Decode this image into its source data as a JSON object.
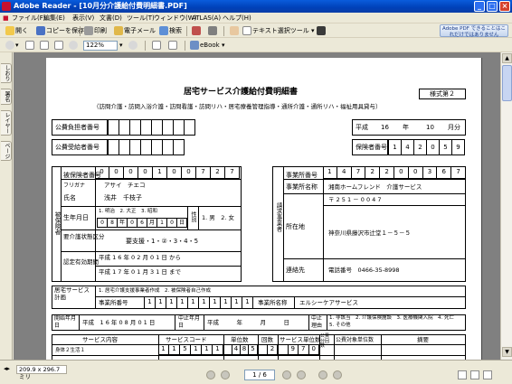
{
  "window": {
    "title": "Adobe Reader - [10月分介護給付費明細書.PDF]",
    "minimize": "_",
    "maximize": "□",
    "close": "×"
  },
  "menu": [
    "ファイル(F)",
    "編集(E)",
    "表示(V)",
    "文書(D)",
    "ツール(T)",
    "ウィンドウ(W)",
    "ATLAS(A)",
    "ヘルプ(H)"
  ],
  "toolbar1": {
    "open": "開く",
    "save_copy": "コピーを保存",
    "print": "印刷",
    "email": "電子メール",
    "search": "検索",
    "text_select": "テキスト選択ツール"
  },
  "toolbar2": {
    "zoom": "122%",
    "ebook": "eBook"
  },
  "adobe_ad": "Adobe PDF できることはこれだけではありません",
  "side_tabs": [
    "しおり",
    "署名",
    "レイヤー",
    "ページ"
  ],
  "status": {
    "page_size": "209.9 x 296.7 ミリ",
    "page_indicator": "1 / 6"
  },
  "form": {
    "title": "居宅サービス介護給付費明細書",
    "subtitle": "（訪問介護・訪問入浴介護・訪問看護・訪問リハ・居宅療養管理指導・通所介護・通所リハ・福祉用具貸与）",
    "form_no": "様式第２",
    "public_payer_label": "公費負担者番号",
    "public_recipient_label": "公費受給者番号",
    "era_label": "平成",
    "year": "16",
    "year_label": "年",
    "month": "10",
    "month_label": "月分",
    "insurer_label": "保険者番号",
    "insurer_no": [
      "1",
      "4",
      "2",
      "0",
      "5",
      "9"
    ],
    "insured_no_label": "被保険者番号",
    "insured_no": [
      "0",
      "0",
      "0",
      "0",
      "1",
      "0",
      "0",
      "7",
      "2",
      "7"
    ],
    "furigana_label": "フリガナ",
    "furigana": "アサイ　チエコ",
    "name_label": "氏名",
    "name": "浅井　千枝子",
    "birth_label": "生年月日",
    "birth_era_options": "1. 明治　2. 大正　3. 昭和",
    "birth_era_selected": "2",
    "birth_date": [
      "0",
      "8",
      "年",
      "0",
      "6",
      "月",
      "1",
      "0",
      "日"
    ],
    "gender_label": "性別",
    "gender_options": "1. 男　2. 女",
    "care_level_label": "要介護状態区分",
    "care_level": "要支援・1・②・3・4・5",
    "cert_period_label": "認定有効期間",
    "cert_from": "平成 1 6 年 0 2 月 0 1 日 から",
    "cert_to": "平成 1 7 年 0 1 月 3 1 日 まで",
    "insured_side_label": "被保険者",
    "provider_side_label": "請求事業者",
    "provider_no_label": "事業所番号",
    "provider_no": [
      "1",
      "4",
      "7",
      "2",
      "2",
      "0",
      "0",
      "3",
      "6",
      "7"
    ],
    "provider_name_label": "事業所名称",
    "provider_name": "湘南ホームフレンド　介護サービス",
    "postal": "〒 2 5 1 － 0 0 4 7",
    "address_label": "所在地",
    "address": "神奈川県藤沢市辻堂１－５－５",
    "contact_label": "連絡先",
    "phone": "電話番号　0466-35-8998",
    "care_plan_label": "居宅サービス計画",
    "care_plan_options": "1. 居宅介護支援事業者作成　2. 被保険者自己作成",
    "care_plan_provider_no_label": "事業所番号",
    "care_plan_provider_no": [
      "1",
      "1",
      "1",
      "1",
      "1",
      "1",
      "1",
      "1",
      "1",
      "1"
    ],
    "care_plan_provider_name_label": "事業所名称",
    "care_plan_provider_name": "エルシーケアサービス",
    "start_label": "開始年月日",
    "start_date": "平成　1 6 年 0 8 月 0 1 日",
    "stop_label": "中止年月日",
    "stop_date": "平成　　　年　　　月　　　日",
    "stop_reason_label": "中止理由",
    "stop_reasons": "1. 非該当　2. 介護保険施設　3. 医療機関入院　4. 死亡　5. その他",
    "service_headers": [
      "サービス内容",
      "サービスコード",
      "単位数",
      "回数",
      "サービス単位数",
      "公費分回数",
      "公費対象単位数",
      "摘要"
    ],
    "service_row": {
      "name": "身体２生活１",
      "code": [
        "1",
        "1",
        "5",
        "1",
        "1",
        "1"
      ],
      "units": [
        "4",
        "8",
        "5"
      ],
      "count": [
        "2"
      ],
      "total": [
        "9",
        "7",
        "0"
      ]
    }
  }
}
